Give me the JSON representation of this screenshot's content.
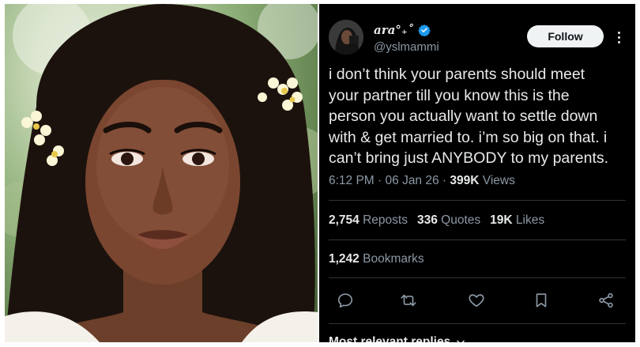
{
  "tweet": {
    "author": {
      "display_name": "ara°₊˚",
      "handle": "@yslmammi",
      "verified": true
    },
    "follow_label": "Follow",
    "text": "i don’t think your parents should meet\nyour partner till you know this is the\nperson you actually want to settle down\nwith & get married to. i’m so big on that. i\ncan’t bring just ANYBODY to my parents.",
    "time": "6:12 PM",
    "date": "06 Jan 26",
    "views_count": "399K",
    "views_label": "Views",
    "reposts_count": "2,754",
    "reposts_label": "Reposts",
    "quotes_count": "336",
    "quotes_label": "Quotes",
    "likes_count": "19K",
    "likes_label": "Likes",
    "bookmarks_count": "1,242",
    "bookmarks_label": "Bookmarks",
    "replies_sort_label": "Most relevant replies"
  },
  "icons": {
    "reply": "reply-icon",
    "repost": "repost-icon",
    "like": "heart-icon",
    "bookmark": "bookmark-icon",
    "share": "share-icon",
    "more": "more-icon",
    "verified": "verified-badge-icon",
    "chevron": "chevron-down-icon"
  },
  "colors": {
    "tweet_background": "#000000",
    "primary_text": "#e7e9ea",
    "secondary_text": "#8b98a5",
    "divider": "#2f3336",
    "verified_blue": "#1d9bf0",
    "follow_button_bg": "#eff3f4"
  }
}
